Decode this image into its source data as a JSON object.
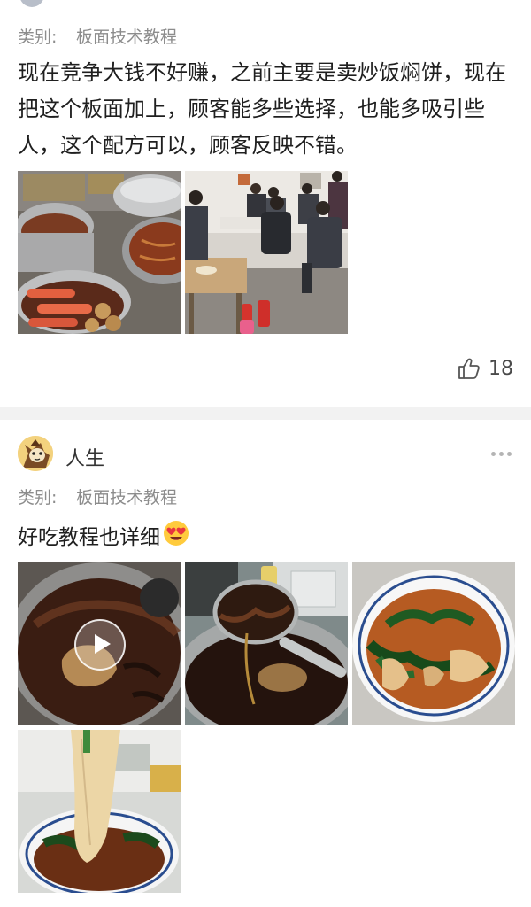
{
  "post1": {
    "partial_username": "",
    "category_label": "类别:",
    "category_value": "板面技术教程",
    "text": "现在竞争大钱不好赚，之前主要是卖炒饭焖饼，现在把这个板面加上，顾客能多些选择，也能多吸引些人，这个配方可以，顾客反映不错。",
    "images": [
      {
        "name": "food-stall-pots-photo",
        "icon": "photo"
      },
      {
        "name": "restaurant-diners-photo",
        "icon": "photo"
      }
    ],
    "likes": "18"
  },
  "post2": {
    "username": "人生",
    "category_label": "类别:",
    "category_value": "板面技术教程",
    "text": "好吃教程也详细",
    "emoji": "😍",
    "images": [
      {
        "name": "video-broth-pot-thumbnail",
        "is_video": true
      },
      {
        "name": "ladle-broth-photo"
      },
      {
        "name": "noodle-bowl-photo"
      },
      {
        "name": "noodle-lift-photo"
      }
    ]
  },
  "colors": {
    "text_primary": "#1f1f1f",
    "text_secondary": "#8c8c8c",
    "separator": "#f2f2f2"
  }
}
